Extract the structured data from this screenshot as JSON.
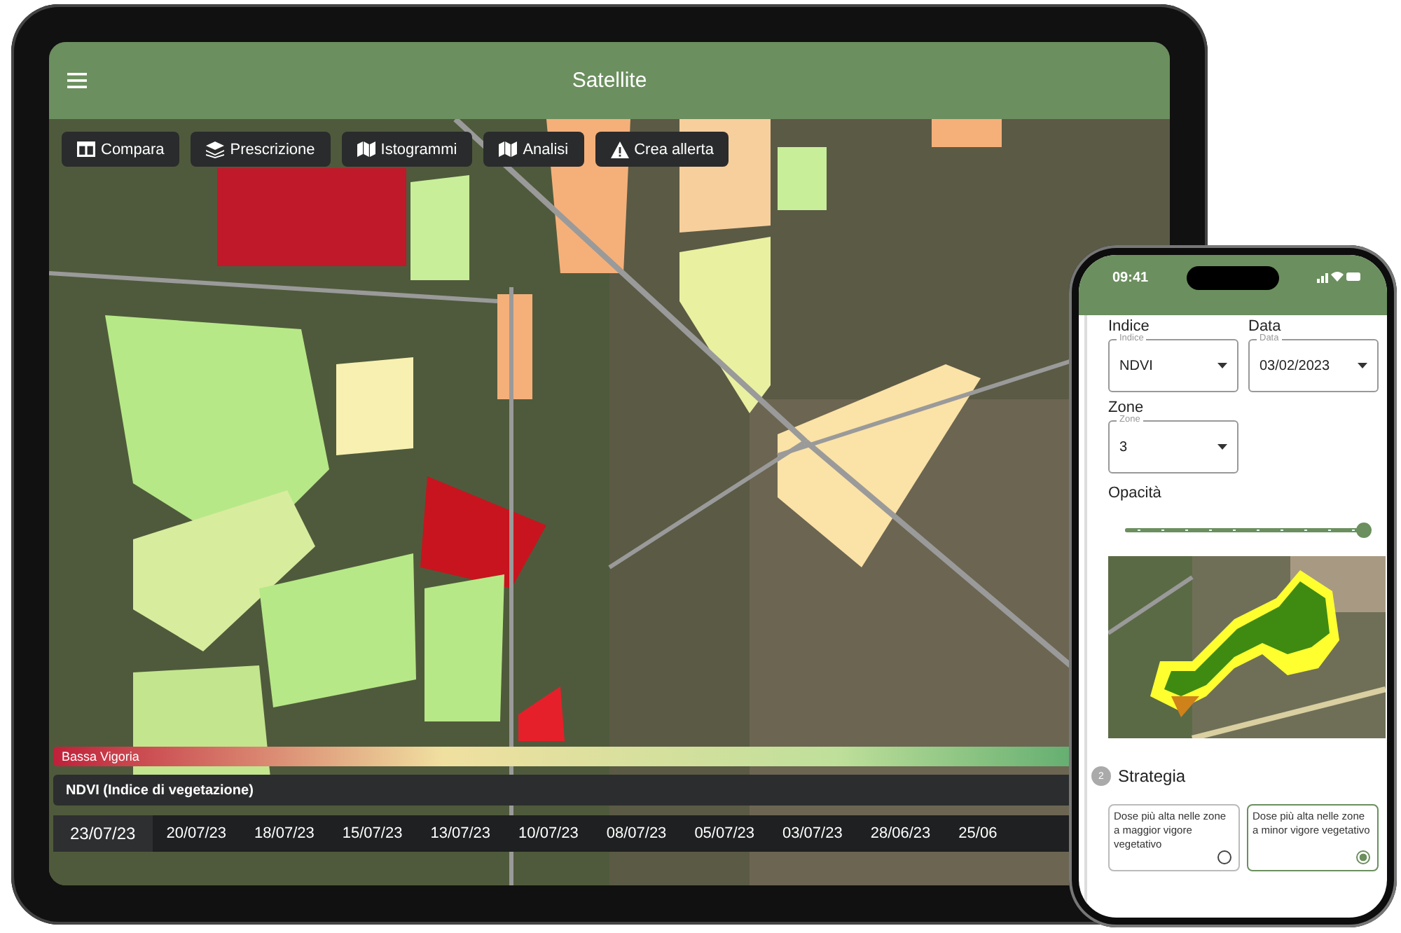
{
  "tablet": {
    "header": {
      "title": "Satellite"
    },
    "toolbar": [
      {
        "label": "Compara"
      },
      {
        "label": "Prescrizione"
      },
      {
        "label": "Istogrammi"
      },
      {
        "label": "Analisi"
      },
      {
        "label": "Crea allerta"
      }
    ],
    "legend": {
      "label": "Bassa Vigoria"
    },
    "index_bar": {
      "label": "NDVI (Indice di vegetazione)"
    },
    "dates": [
      {
        "label": "23/07/23",
        "selected": true
      },
      {
        "label": "20/07/23",
        "selected": false
      },
      {
        "label": "18/07/23",
        "selected": false
      },
      {
        "label": "15/07/23",
        "selected": false
      },
      {
        "label": "13/07/23",
        "selected": false
      },
      {
        "label": "10/07/23",
        "selected": false
      },
      {
        "label": "08/07/23",
        "selected": false
      },
      {
        "label": "05/07/23",
        "selected": false
      },
      {
        "label": "03/07/23",
        "selected": false
      },
      {
        "label": "28/06/23",
        "selected": false
      },
      {
        "label": "25/06",
        "selected": false
      }
    ]
  },
  "phone": {
    "status_bar": {
      "time": "09:41"
    },
    "fields": [
      {
        "heading": "Indice",
        "label": "Indice",
        "value": "NDVI"
      },
      {
        "heading": "Data",
        "label": "Data",
        "value": "03/02/2023"
      },
      {
        "heading": "Zone",
        "label": "Zone",
        "value": "3"
      }
    ],
    "opacity": {
      "label": "Opacità",
      "level": 1
    },
    "strategy": {
      "step": "2",
      "title": "Strategia",
      "options": [
        {
          "text": "Dose più alta nelle zone a maggior vigore vegetativo",
          "selected": false
        },
        {
          "text": "Dose più alta nelle zone a minor vigore vegetativo",
          "selected": true
        }
      ]
    }
  }
}
